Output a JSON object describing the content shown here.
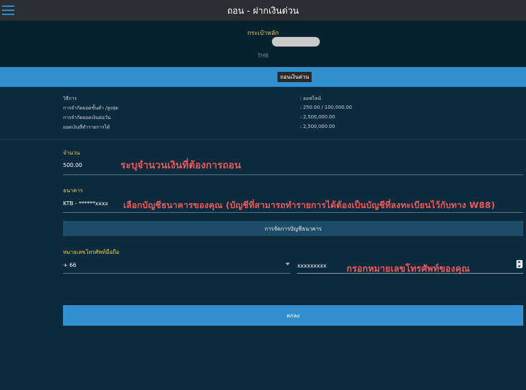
{
  "header": {
    "title": "ถอน - ฝากเงินด่วน"
  },
  "wallet": {
    "label": "กระเป๋าหลัก",
    "currency": "THB"
  },
  "tabs": {
    "active_label": "ถอนเงินด่วน"
  },
  "info": {
    "rows": [
      {
        "label": "วิธีการ",
        "value": ": ออฟไลน์"
      },
      {
        "label": "การจำกัดยอดขั้นต่ำ /สูงสุด",
        "value": ": 250.00 / 100,000.00"
      },
      {
        "label": "การจำกัดยอดเงินต่อวัน",
        "value": ": 2,500,000.00"
      },
      {
        "label": "ยอดเงินที่ทำรายการได้",
        "value": ": 2,500,000.00"
      }
    ]
  },
  "amount": {
    "label": "จำนวน",
    "value": "500.00",
    "annotation": "ระบุจำนวนเงินที่ต้องการถอน"
  },
  "bank": {
    "label": "ธนาคาร",
    "value": "KTB - ******xxxx",
    "annotation": "เลือกบัญชีธนาคารของคุณ  (บัญชีที่สามารถทำรายการได้ต้องเป็นบัญชีที่ลงทะเบียนไว้กับทาง W88)",
    "manage_label": "การจัดการบัญชีธนาคาร"
  },
  "phone": {
    "label": "หมายเลขโทรศัพท์มือถือ",
    "country_code": "+ 66",
    "number": "xxxxxxxxx",
    "annotation": "กรอกหมายเลขโทรศัพท์ของคุณ"
  },
  "submit": {
    "label": "ตกลง"
  },
  "colors": {
    "background": "#0b2a3b",
    "accent": "#2f8fcf",
    "label_yellow": "#f2c94c",
    "annotation_red": "#f05a5a"
  },
  "icons": {
    "menu": "hamburger-icon",
    "dropdown": "chevron-down-icon",
    "stepper": "stepper-icon"
  }
}
